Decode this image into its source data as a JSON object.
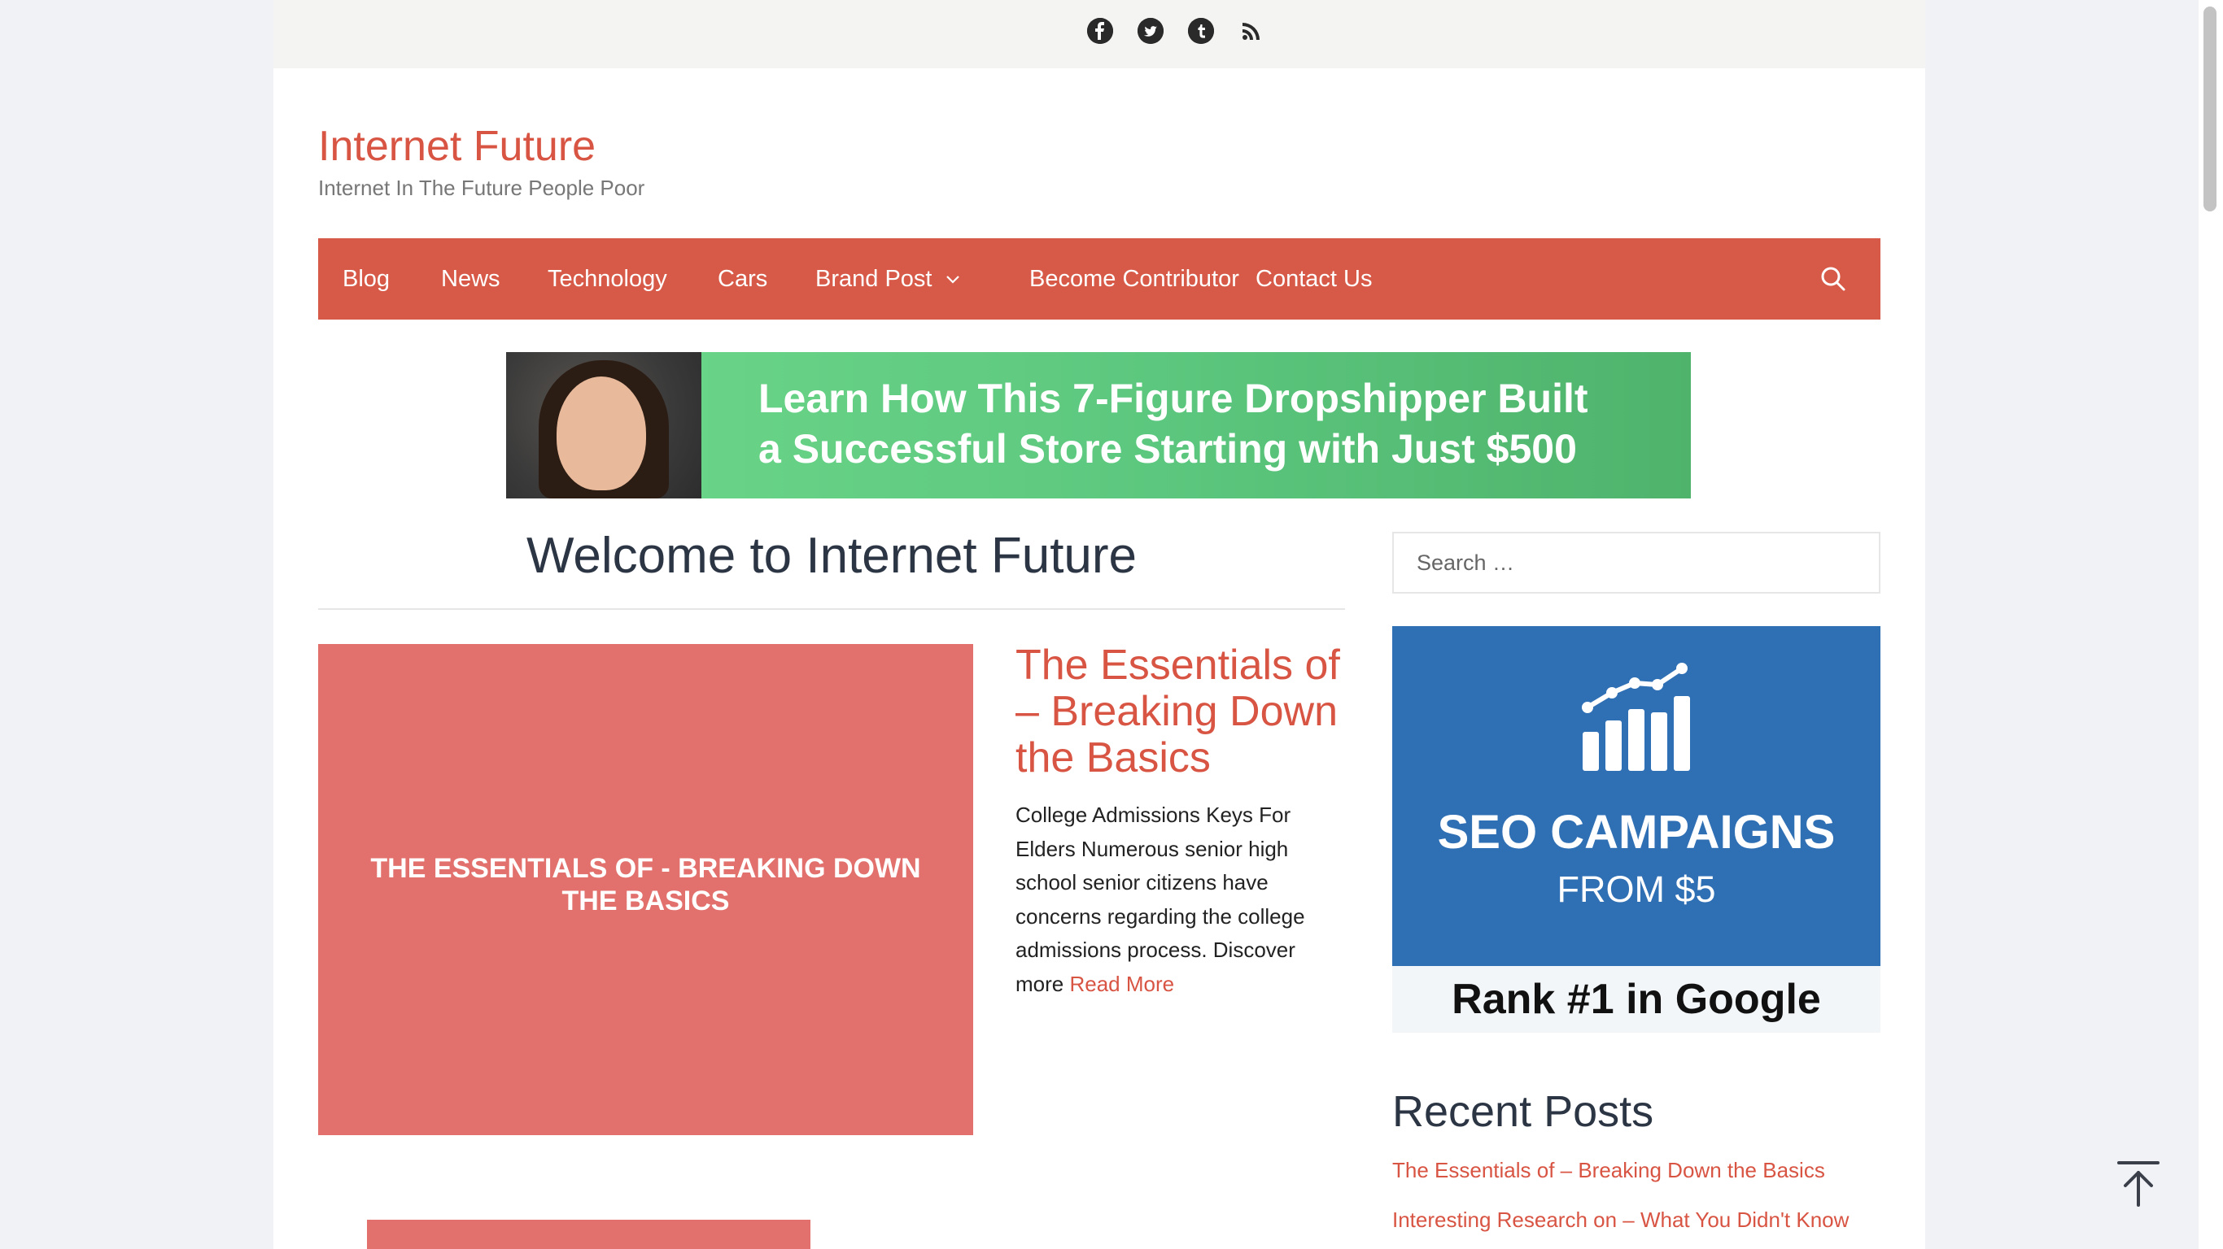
{
  "social": {
    "facebook": "f",
    "twitter": "t",
    "tumblr": "t",
    "rss": "rss"
  },
  "site": {
    "title": "Internet Future",
    "tagline": "Internet In The Future People Poor"
  },
  "nav": {
    "items": [
      "Blog",
      "News",
      "Technology",
      "Cars",
      "Brand Post",
      "Become Contributor",
      "Contact Us"
    ],
    "dropdown_item": "Brand Post"
  },
  "banner": {
    "line1": "Learn How This 7-Figure Dropshipper Built",
    "line2": "a Successful Store Starting with Just $500"
  },
  "main": {
    "heading": "Welcome to Internet Future",
    "post": {
      "thumb_text": "THE ESSENTIALS OF   - BREAKING DOWN THE BASICS",
      "title": "The Essentials of – Breaking Down the Basics",
      "excerpt": "College Admissions Keys For Elders Numerous senior high school senior citizens have concerns regarding the college admissions process. Discover more",
      "read_more": "Read More"
    }
  },
  "sidebar": {
    "search_placeholder": "Search …",
    "ad": {
      "line1": "SEO CAMPAIGNS",
      "line2": "FROM $5",
      "bottom": "Rank #1 in Google"
    },
    "recent_heading": "Recent Posts",
    "recent_posts": [
      "The Essentials of – Breaking Down the Basics",
      "Interesting Research on – What You Didn't Know"
    ]
  },
  "colors": {
    "accent": "#d85443",
    "nav_bg": "#d75a48",
    "thumb_bg": "#e2706d",
    "ad_blue": "#2f6fb4"
  }
}
